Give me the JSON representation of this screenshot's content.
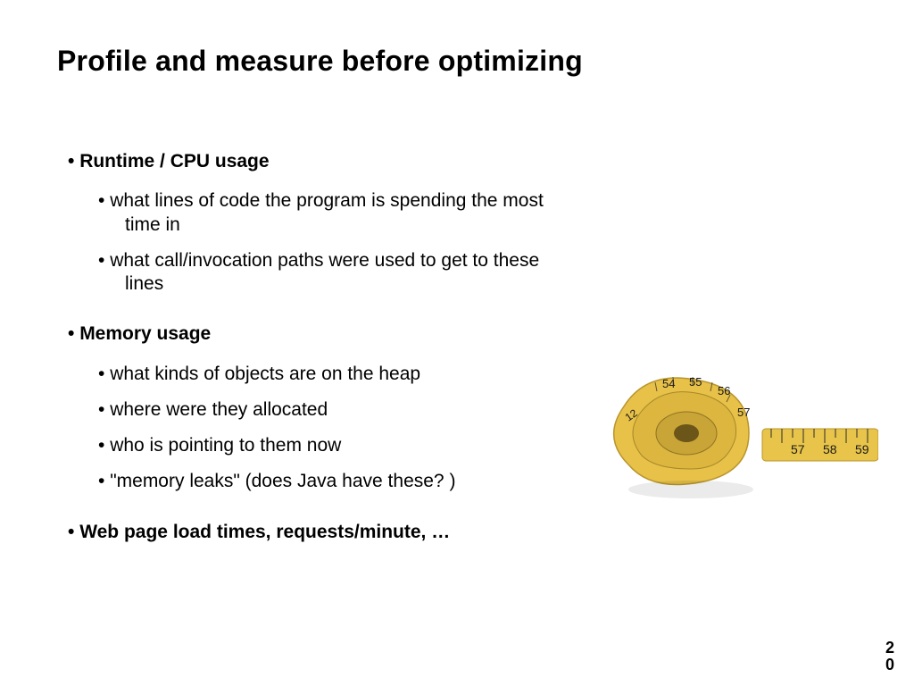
{
  "title": "Profile and measure before optimizing",
  "sections": [
    {
      "heading": "Runtime / CPU usage",
      "items": [
        "what lines of code the program is spending  the most time in",
        "what call/invocation paths were used to get to  these lines"
      ]
    },
    {
      "heading": "Memory usage",
      "items": [
        "what kinds of objects are on the heap",
        "where were they allocated",
        "who is pointing to them now",
        "\"memory leaks\" (does Java have these? )"
      ]
    },
    {
      "heading": "Web page load times, requests/minute, …",
      "items": []
    }
  ],
  "illustration": "measuring-tape",
  "tape_numbers_left": [
    "12",
    "54",
    "55",
    "56",
    "57"
  ],
  "tape_numbers_right": [
    "57",
    "58",
    "59"
  ],
  "page_number_top": "2",
  "page_number_bottom": "0"
}
